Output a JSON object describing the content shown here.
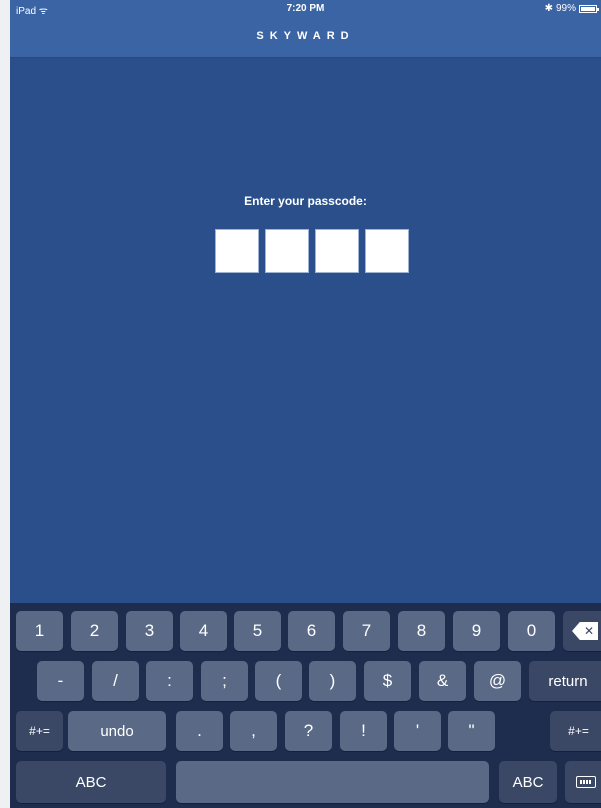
{
  "status_bar": {
    "device": "iPad ᯤ",
    "time": "7:20 PM",
    "bluetooth": "✱",
    "battery": "99%"
  },
  "nav_bar": {
    "logo": "SKYWARD"
  },
  "passcode": {
    "prompt": "Enter your passcode:",
    "digits": [
      "",
      "",
      "",
      ""
    ]
  },
  "keyboard": {
    "row1": [
      "1",
      "2",
      "3",
      "4",
      "5",
      "6",
      "7",
      "8",
      "9",
      "0"
    ],
    "row2": [
      "-",
      "/",
      ":",
      ";",
      "(",
      ")",
      "$",
      "&",
      "@"
    ],
    "row2_return": "return",
    "row3_left": "#+=",
    "row3_undo": "undo",
    "row3": [
      ".",
      ",",
      "?",
      "!",
      "'",
      "\""
    ],
    "row3_right": "#+=",
    "row4_left": "ABC",
    "row4_right": "ABC",
    "delete_glyph": "✕"
  },
  "colors": {
    "background": "#2b4f8b",
    "navbar": "#3a64a4",
    "keyboard": "#1e2d4d",
    "key": "#5a6a86"
  }
}
